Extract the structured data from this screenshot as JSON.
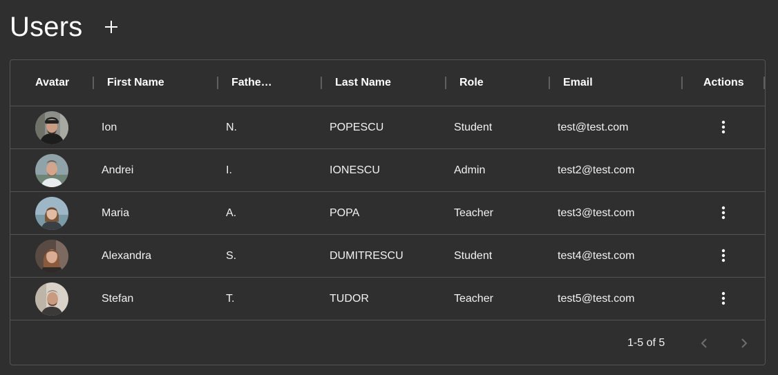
{
  "header": {
    "title": "Users",
    "add_icon": "plus-icon"
  },
  "table": {
    "columns": [
      "Avatar",
      "First Name",
      "Fathe…",
      "Last Name",
      "Role",
      "Email",
      "Actions"
    ],
    "rows": [
      {
        "first_name": "Ion",
        "father_initial": "N.",
        "last_name": "POPESCU",
        "role": "Student",
        "email": "test@test.com",
        "has_actions": true
      },
      {
        "first_name": "Andrei",
        "father_initial": "I.",
        "last_name": "IONESCU",
        "role": "Admin",
        "email": "test2@test.com",
        "has_actions": false
      },
      {
        "first_name": "Maria",
        "father_initial": "A.",
        "last_name": "POPA",
        "role": "Teacher",
        "email": "test3@test.com",
        "has_actions": true
      },
      {
        "first_name": "Alexandra",
        "father_initial": "S.",
        "last_name": "DUMITRESCU",
        "role": "Student",
        "email": "test4@test.com",
        "has_actions": true
      },
      {
        "first_name": "Stefan",
        "father_initial": "T.",
        "last_name": "TUDOR",
        "role": "Teacher",
        "email": "test5@test.com",
        "has_actions": true
      }
    ]
  },
  "pagination": {
    "label": "1-5 of 5",
    "prev_icon": "chevron-left-icon",
    "next_icon": "chevron-right-icon"
  },
  "colors": {
    "background": "#2f2f2f",
    "border": "#555555",
    "text": "#ffffff",
    "disabled_icon": "#6f6f6f"
  }
}
